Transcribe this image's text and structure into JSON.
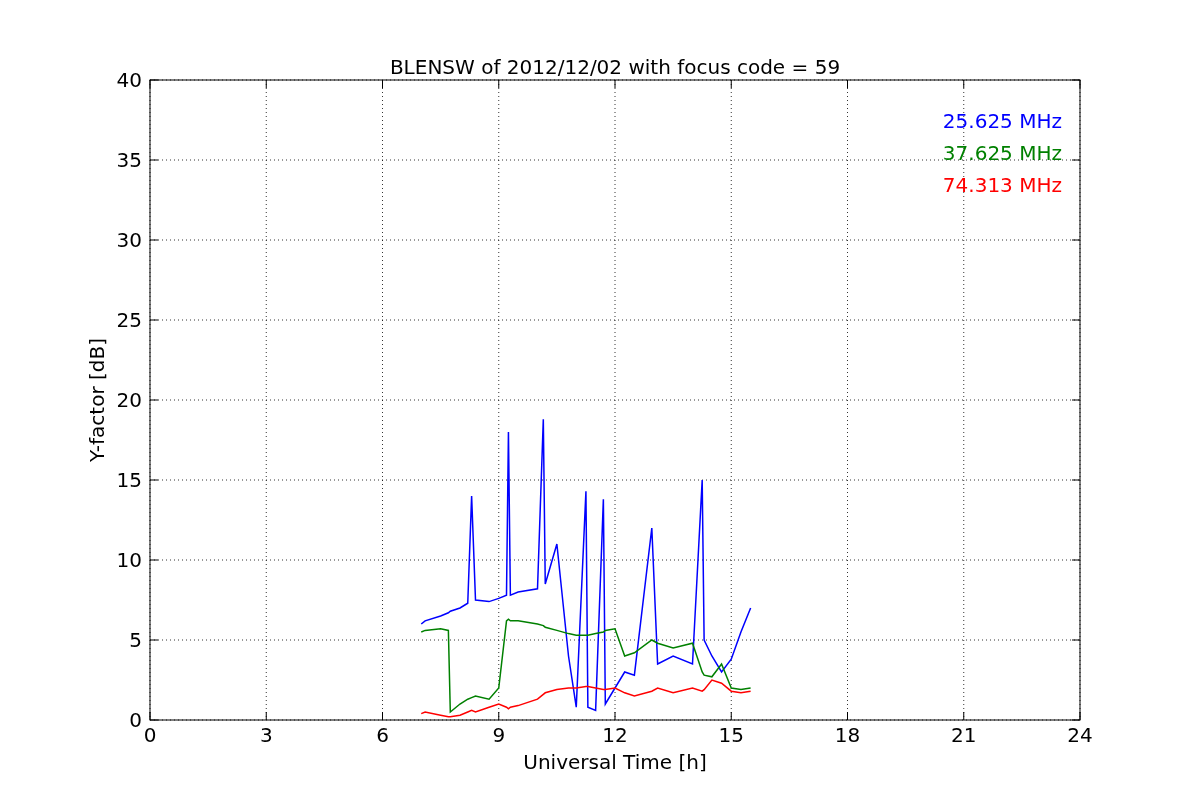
{
  "chart_data": {
    "type": "line",
    "title": "BLENSW of 2012/12/02 with focus code = 59",
    "xlabel": "Universal Time [h]",
    "ylabel": "Y-factor [dB]",
    "xlim": [
      0,
      24
    ],
    "ylim": [
      0,
      40
    ],
    "xticks": [
      0,
      3,
      6,
      9,
      12,
      15,
      18,
      21,
      24
    ],
    "yticks": [
      0,
      5,
      10,
      15,
      20,
      25,
      30,
      35,
      40
    ],
    "grid": true,
    "x": [
      7.0,
      7.1,
      7.5,
      7.7,
      7.75,
      8.0,
      8.2,
      8.3,
      8.4,
      8.75,
      9.0,
      9.2,
      9.25,
      9.3,
      9.5,
      10.0,
      10.15,
      10.2,
      10.5,
      10.8,
      11.0,
      11.25,
      11.3,
      11.5,
      11.7,
      11.75,
      12.0,
      12.25,
      12.5,
      12.95,
      13.1,
      13.5,
      14.0,
      14.25,
      14.3,
      14.5,
      14.75,
      15.0,
      15.25,
      15.5
    ],
    "series": [
      {
        "name": "25.625 MHz",
        "color": "#0000ff",
        "values": [
          6.0,
          6.2,
          6.5,
          6.7,
          6.8,
          7.0,
          7.3,
          14.0,
          7.5,
          7.4,
          7.6,
          7.8,
          18.0,
          7.8,
          8.0,
          8.2,
          18.8,
          8.5,
          11.0,
          4.0,
          0.8,
          14.3,
          0.8,
          0.6,
          13.8,
          1.0,
          2.0,
          3.0,
          2.8,
          12.0,
          3.5,
          4.0,
          3.5,
          15.0,
          5.0,
          4.0,
          3.0,
          3.8,
          5.5,
          7.0
        ]
      },
      {
        "name": "37.625 MHz",
        "color": "#008000",
        "values": [
          5.5,
          5.6,
          5.7,
          5.6,
          0.5,
          1.0,
          1.3,
          1.4,
          1.5,
          1.3,
          2.0,
          6.2,
          6.3,
          6.2,
          6.2,
          6.0,
          5.9,
          5.8,
          5.6,
          5.4,
          5.3,
          5.3,
          5.3,
          5.4,
          5.5,
          5.6,
          5.7,
          4.0,
          4.2,
          5.0,
          4.8,
          4.5,
          4.8,
          3.0,
          2.8,
          2.7,
          3.5,
          2.0,
          1.9,
          2.0
        ]
      },
      {
        "name": "74.313 MHz",
        "color": "#ff0000",
        "values": [
          0.4,
          0.5,
          0.3,
          0.2,
          0.2,
          0.3,
          0.5,
          0.6,
          0.5,
          0.8,
          1.0,
          0.8,
          0.7,
          0.8,
          0.9,
          1.3,
          1.6,
          1.7,
          1.9,
          2.0,
          2.0,
          2.1,
          2.1,
          2.0,
          1.9,
          1.9,
          2.0,
          1.7,
          1.5,
          1.8,
          2.0,
          1.7,
          2.0,
          1.8,
          1.9,
          2.5,
          2.3,
          1.8,
          1.7,
          1.8
        ]
      }
    ]
  }
}
